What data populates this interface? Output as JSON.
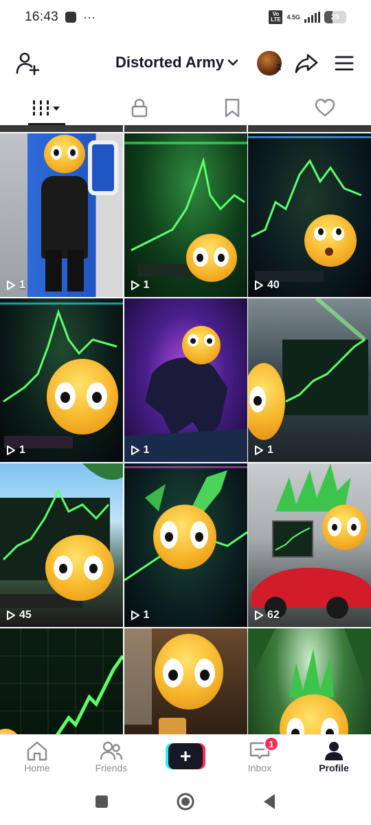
{
  "status_bar": {
    "time": "16:43",
    "dots": "···",
    "volte": "Vo LTE",
    "network": "4.5G",
    "battery": "25"
  },
  "header": {
    "title": "Distorted Army",
    "avatar_count": "2",
    "icons": [
      "add-user-icon",
      "chevron-down-icon",
      "share-icon",
      "menu-icon"
    ]
  },
  "tabs": [
    {
      "name": "videos",
      "icon": "grid-sort-icon",
      "active": true
    },
    {
      "name": "private",
      "icon": "lock-icon",
      "active": false
    },
    {
      "name": "saved",
      "icon": "bookmark-icon",
      "active": false
    },
    {
      "name": "liked",
      "icon": "heart-icon",
      "active": false
    }
  ],
  "videos": [
    {
      "views": "1"
    },
    {
      "views": "1"
    },
    {
      "views": "40"
    },
    {
      "views": "1"
    },
    {
      "views": "1"
    },
    {
      "views": "1"
    },
    {
      "views": "45"
    },
    {
      "views": "1"
    },
    {
      "views": "62"
    },
    {
      "views": ""
    },
    {
      "views": ""
    },
    {
      "views": ""
    }
  ],
  "bottom_nav": {
    "home": "Home",
    "friends": "Friends",
    "create": "+",
    "inbox": "Inbox",
    "inbox_badge": "1",
    "profile": "Profile"
  },
  "colors": {
    "accent_red": "#fe2c55",
    "accent_cyan": "#25f4ee",
    "text": "#161823",
    "muted": "#8a8b91"
  }
}
